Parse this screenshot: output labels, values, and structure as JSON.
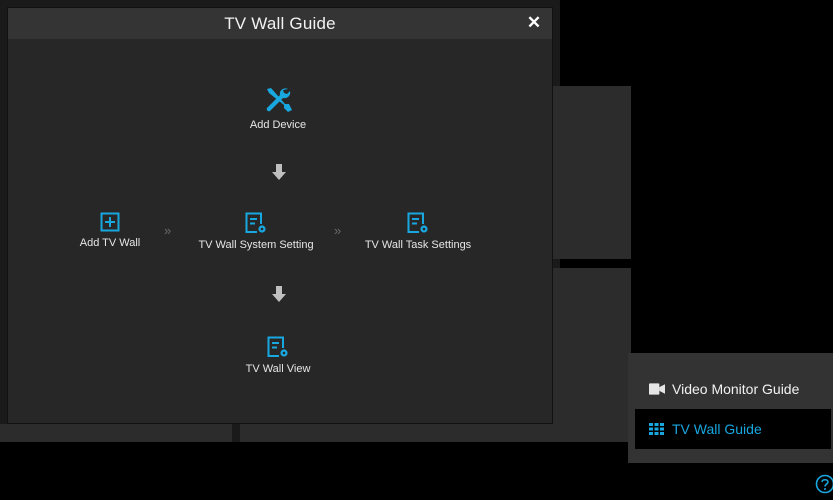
{
  "dialog": {
    "title": "TV Wall Guide",
    "close_icon": "close-icon"
  },
  "steps": {
    "add_device": {
      "label": "Add Device",
      "icon": "tools-icon"
    },
    "add_tv_wall": {
      "label": "Add TV Wall",
      "icon": "plus-square-icon"
    },
    "system_setting": {
      "label": "TV Wall System Setting",
      "icon": "settings-doc-icon"
    },
    "task_settings": {
      "label": "TV Wall Task Settings",
      "icon": "settings-doc-icon"
    },
    "tv_wall_view": {
      "label": "TV Wall View",
      "icon": "settings-doc-icon"
    }
  },
  "guide_menu": {
    "items": [
      {
        "label": "Video Monitor Guide",
        "icon": "video-camera-icon",
        "active": false
      },
      {
        "label": "TV Wall Guide",
        "icon": "grid-icon",
        "active": true
      }
    ]
  },
  "colors": {
    "accent": "#19a7e0",
    "dialog_bg": "#272727",
    "header_bg": "#343434"
  }
}
